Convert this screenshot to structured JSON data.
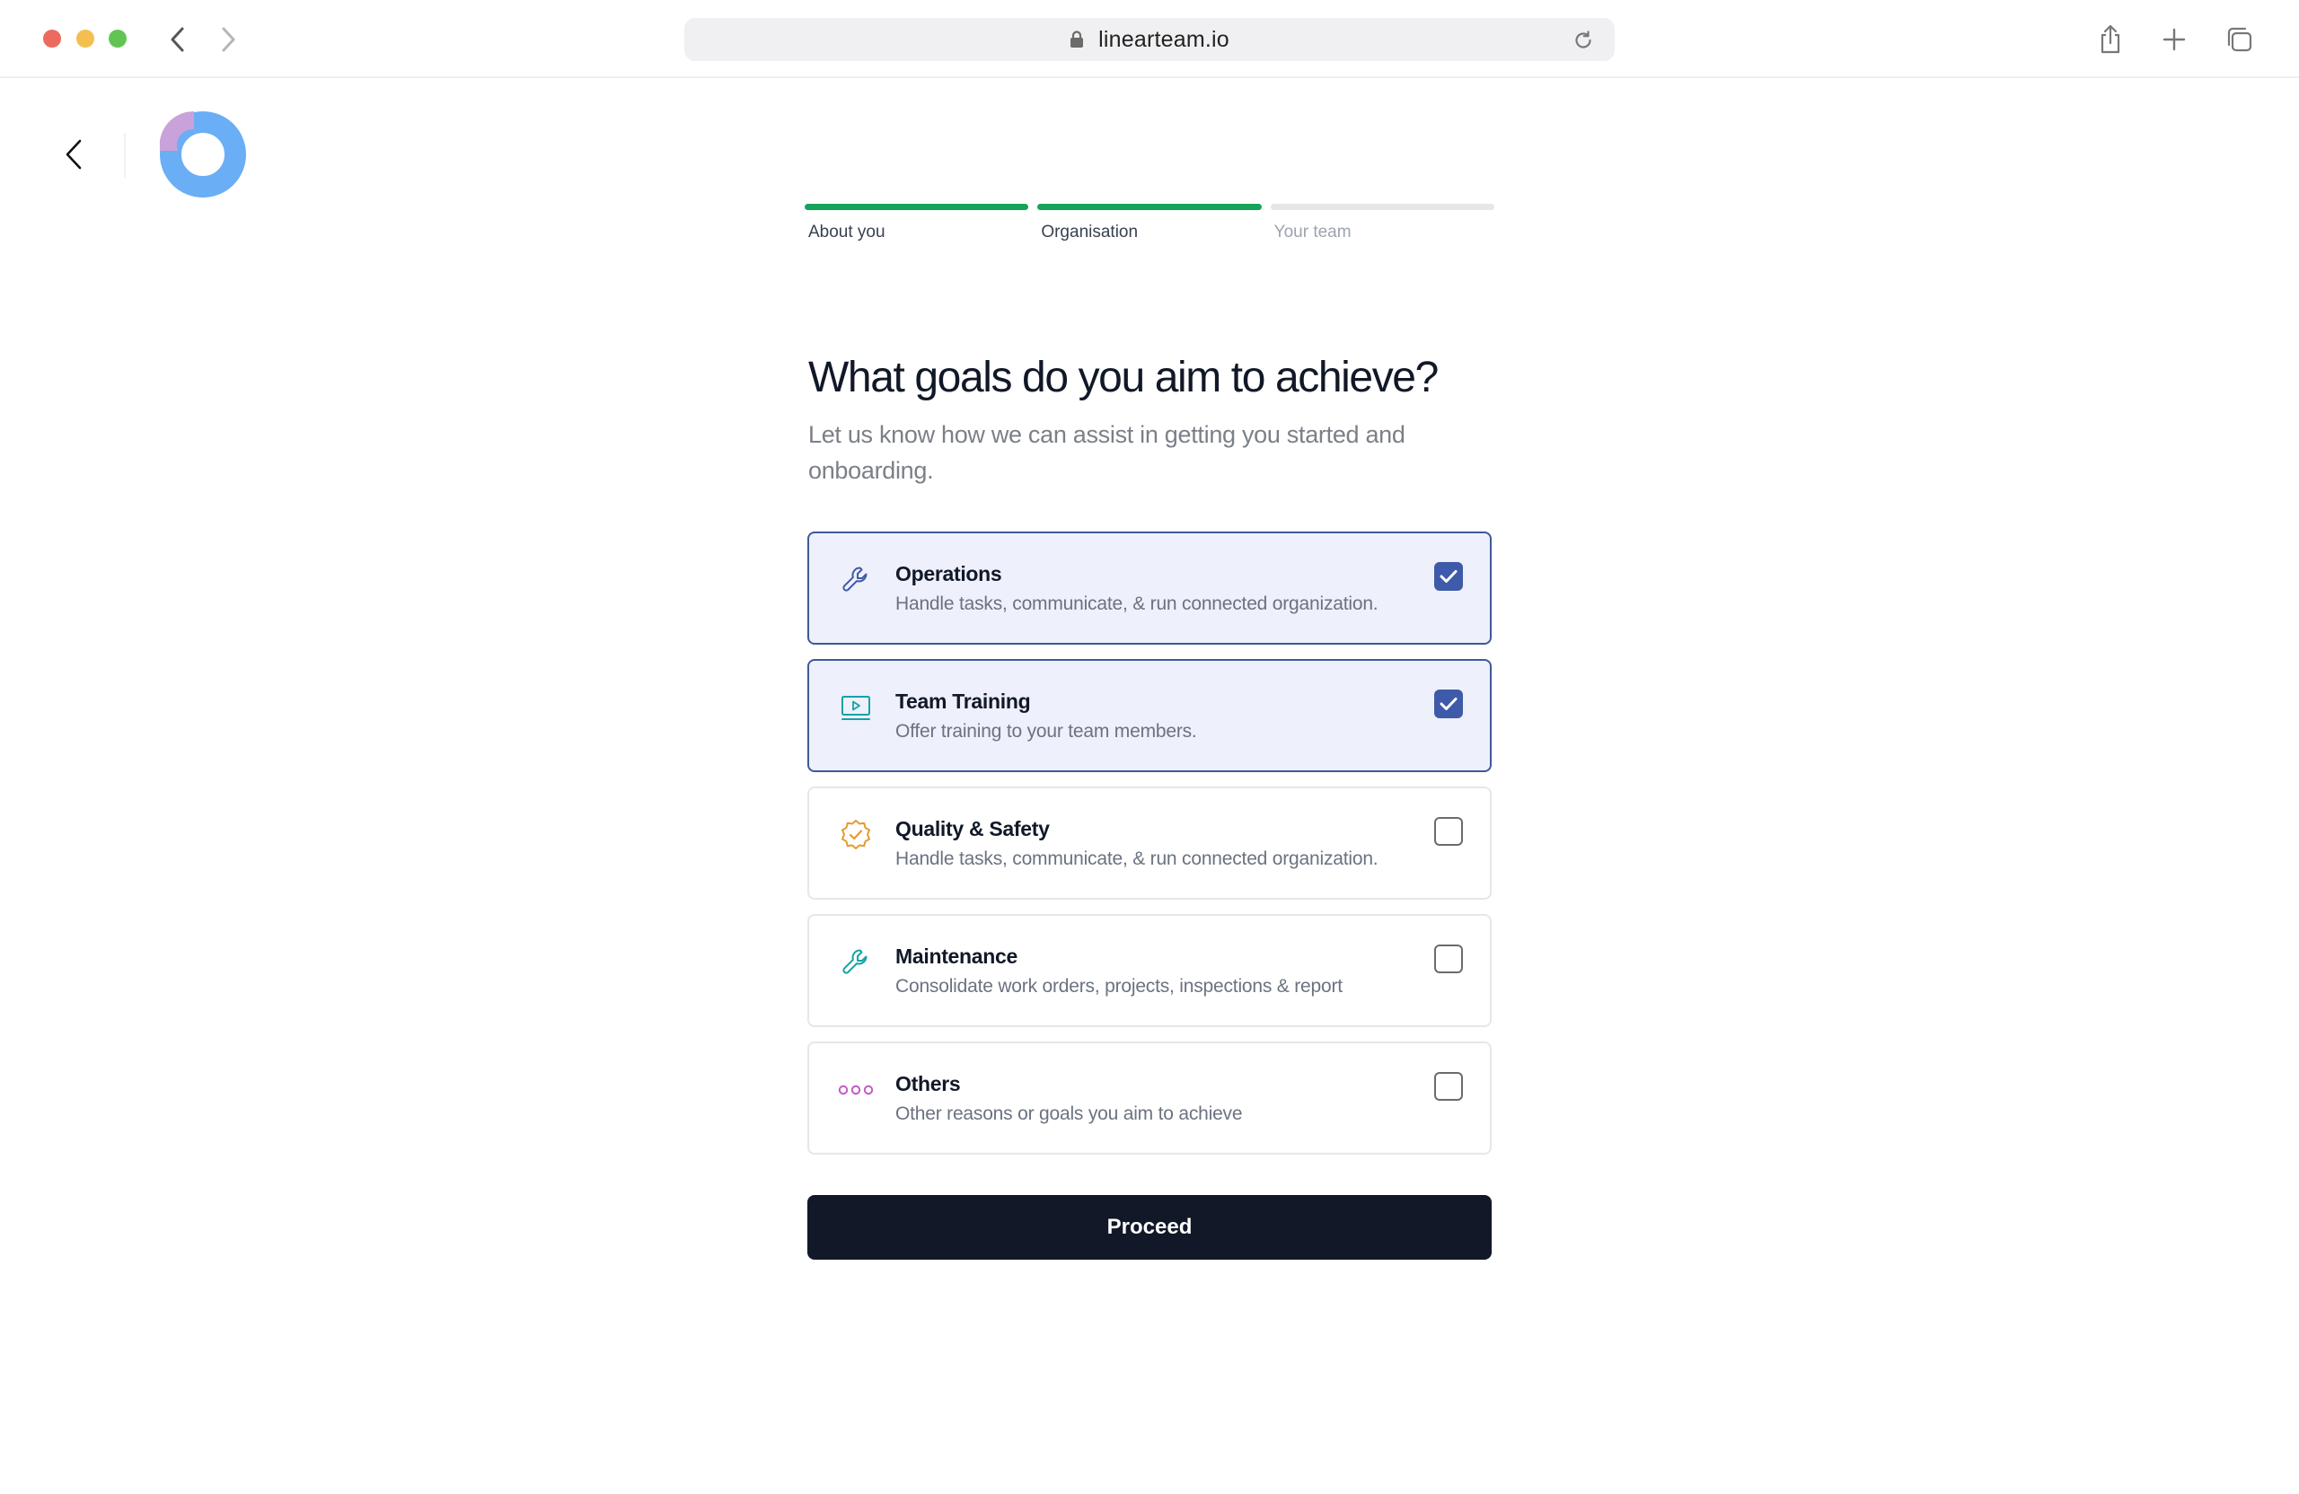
{
  "browser": {
    "url": "linearteam.io"
  },
  "stepper": {
    "steps": [
      {
        "label": "About you",
        "status": "done"
      },
      {
        "label": "Organisation",
        "status": "done"
      },
      {
        "label": "Your team",
        "status": "pending"
      }
    ]
  },
  "main": {
    "title": "What goals do you aim to achieve?",
    "subtitle": "Let us know how we can assist in getting you started and onboarding."
  },
  "options": [
    {
      "title": "Operations",
      "description": "Handle tasks, communicate, & run connected organization.",
      "icon": "wrench-icon",
      "icon_color": "#3f5aa8",
      "checked": true
    },
    {
      "title": "Team Training",
      "description": "Offer training to your team members.",
      "icon": "video-play-icon",
      "icon_color": "#14a3a3",
      "checked": true
    },
    {
      "title": "Quality & Safety",
      "description": "Handle tasks, communicate, & run connected organization.",
      "icon": "badge-check-icon",
      "icon_color": "#e69a2e",
      "checked": false
    },
    {
      "title": "Maintenance",
      "description": "Consolidate work orders, projects, inspections & report",
      "icon": "wrench-icon",
      "icon_color": "#14a3a3",
      "checked": false
    },
    {
      "title": "Others",
      "description": "Other reasons or goals you aim to achieve",
      "icon": "more-dots-icon",
      "icon_color": "#c05bc5",
      "checked": false
    }
  ],
  "actions": {
    "proceed_label": "Proceed"
  },
  "colors": {
    "progress_done": "#17a35a",
    "selected_border": "#3f5998",
    "selected_bg": "#eef0fb",
    "primary_button": "#111827",
    "logo_blue": "#6aaef5",
    "logo_purple": "#c8a2d8"
  }
}
